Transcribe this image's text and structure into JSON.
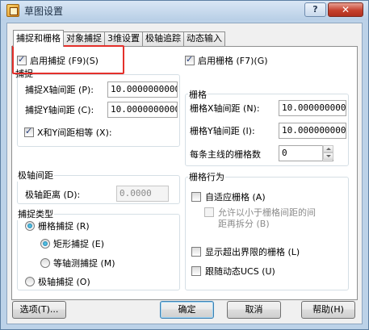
{
  "window": {
    "title": "草图设置",
    "help_label": "?",
    "close_label": "✕"
  },
  "tabs": [
    {
      "label": "捕捉和栅格",
      "active": true
    },
    {
      "label": "对象捕捉",
      "active": false
    },
    {
      "label": "3维设置",
      "active": false
    },
    {
      "label": "极轴追踪",
      "active": false
    },
    {
      "label": "动态输入",
      "active": false
    }
  ],
  "snap": {
    "enable_label": "启用捕捉 (F9)(S)",
    "enable_checked": true,
    "group_title": "捕捉",
    "x_spacing_label": "捕捉X轴间距 (P):",
    "x_spacing_value": "10.0000000000",
    "y_spacing_label": "捕捉Y轴间距 (C):",
    "y_spacing_value": "10.0000000000",
    "equal_xy_label": "X和Y间距相等 (X):",
    "equal_xy_checked": true
  },
  "polar": {
    "group_title": "极轴间距",
    "distance_label": "极轴距离 (D):",
    "distance_value": "0.0000"
  },
  "snap_type": {
    "group_title": "捕捉类型",
    "grid_snap_label": "栅格捕捉 (R)",
    "rect_snap_label": "矩形捕捉 (E)",
    "iso_snap_label": "等轴测捕捉 (M)",
    "polar_snap_label": "极轴捕捉 (O)"
  },
  "grid": {
    "enable_label": "启用栅格 (F7)(G)",
    "enable_checked": true,
    "group_title": "栅格",
    "x_spacing_label": "栅格X轴间距 (N):",
    "x_spacing_value": "10.0000000000",
    "y_spacing_label": "栅格Y轴间距 (I):",
    "y_spacing_value": "10.0000000000",
    "major_label": "每条主线的栅格数",
    "major_value": "0"
  },
  "grid_behavior": {
    "group_title": "栅格行为",
    "adaptive_label": "自适应栅格 (A)",
    "subdivide_label_1": "允许以小于栅格间距的间",
    "subdivide_label_2": "距再拆分 (B)",
    "beyond_limits_label": "显示超出界限的栅格 (L)",
    "follow_ucs_label": "跟随动态UCS (U)"
  },
  "buttons": {
    "options": "选项(T)...",
    "ok": "确定",
    "cancel": "取消",
    "help": "帮助(H)"
  }
}
